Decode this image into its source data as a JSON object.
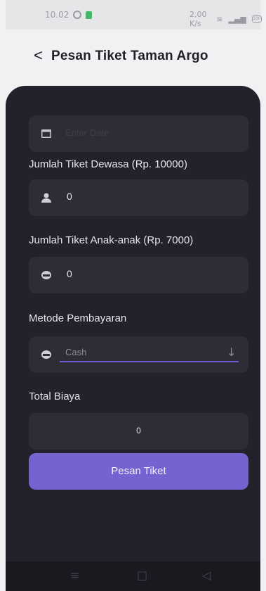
{
  "status_bar": {
    "time": "10.02",
    "right_text": "2,00 K/s",
    "battery": "100"
  },
  "header": {
    "back_glyph": "<",
    "title": "Pesan Tiket Taman Argo"
  },
  "form": {
    "date_placeholder": "Enter Date",
    "adult_label": "Jumlah Tiket Dewasa (Rp. 10000)",
    "adult_value": "0",
    "child_label": "Jumlah Tiket Anak-anak (Rp. 7000)",
    "child_value": "0",
    "payment_label": "Metode Pembayaran",
    "payment_value": "Cash",
    "total_label": "Total Biaya",
    "total_value": "0",
    "submit_label": "Pesan Tiket"
  },
  "icons": {
    "calendar": "calendar-icon",
    "person": "person-icon",
    "child": "child-icon",
    "payment": "money-icon",
    "dropdown": "arrow-down-icon"
  },
  "colors": {
    "panel": "#23212b",
    "field": "#2e2c36",
    "accent": "#7663d1",
    "background": "#f1f1f3"
  }
}
